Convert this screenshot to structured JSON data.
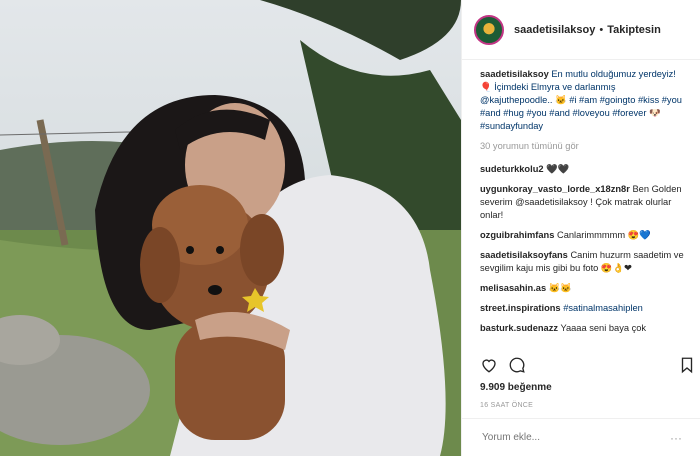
{
  "post": {
    "username": "saadetisilaksoy",
    "follow_status": "Takiptesin",
    "caption_user": "saadetisilaksoy",
    "caption_text": "En mutlu olduğumuz yerdeyiz! 🎈 İçimdeki Elmyra ve darlanmış @kajuthepoodle.. 🐱 #i #am #goingto #kiss #you #and #hug #you #and #loveyou #forever 🐶 #sundayfunday",
    "view_all": "30 yorumun tümünü gör",
    "likes": "9.909 beğenme",
    "time_ago": "16 SAAT ÖNCE",
    "comment_placeholder": "Yorum ekle...",
    "more_label": "···"
  },
  "comments": [
    {
      "user": "sudeturkkolu2",
      "text": "🖤🖤"
    },
    {
      "user": "uygunkoray_vasto_lorde_x18zn8r",
      "text": "Ben Golden severim @saadetisilaksoy ! Çok matrak olurlar onlar!"
    },
    {
      "user": "ozguibrahimfans",
      "text": "Canlarimmmmm 😍💙"
    },
    {
      "user": "saadetisilaksoyfans",
      "text": "Canim huzurm saadetim ve sevgilim kaju mis gibi bu foto 😍👌❤"
    },
    {
      "user": "melisasahin.as",
      "text": "🐱🐱"
    },
    {
      "user": "street.inspirations",
      "text": "#satinalmasahiplen"
    },
    {
      "user": "basturk.sudenazz",
      "text": "Yaaaa seni baya çok"
    }
  ],
  "colors": {
    "link": "#003569",
    "muted": "#999999",
    "border": "#efefef"
  },
  "icons": [
    "heart-icon",
    "comment-icon",
    "bookmark-icon"
  ]
}
